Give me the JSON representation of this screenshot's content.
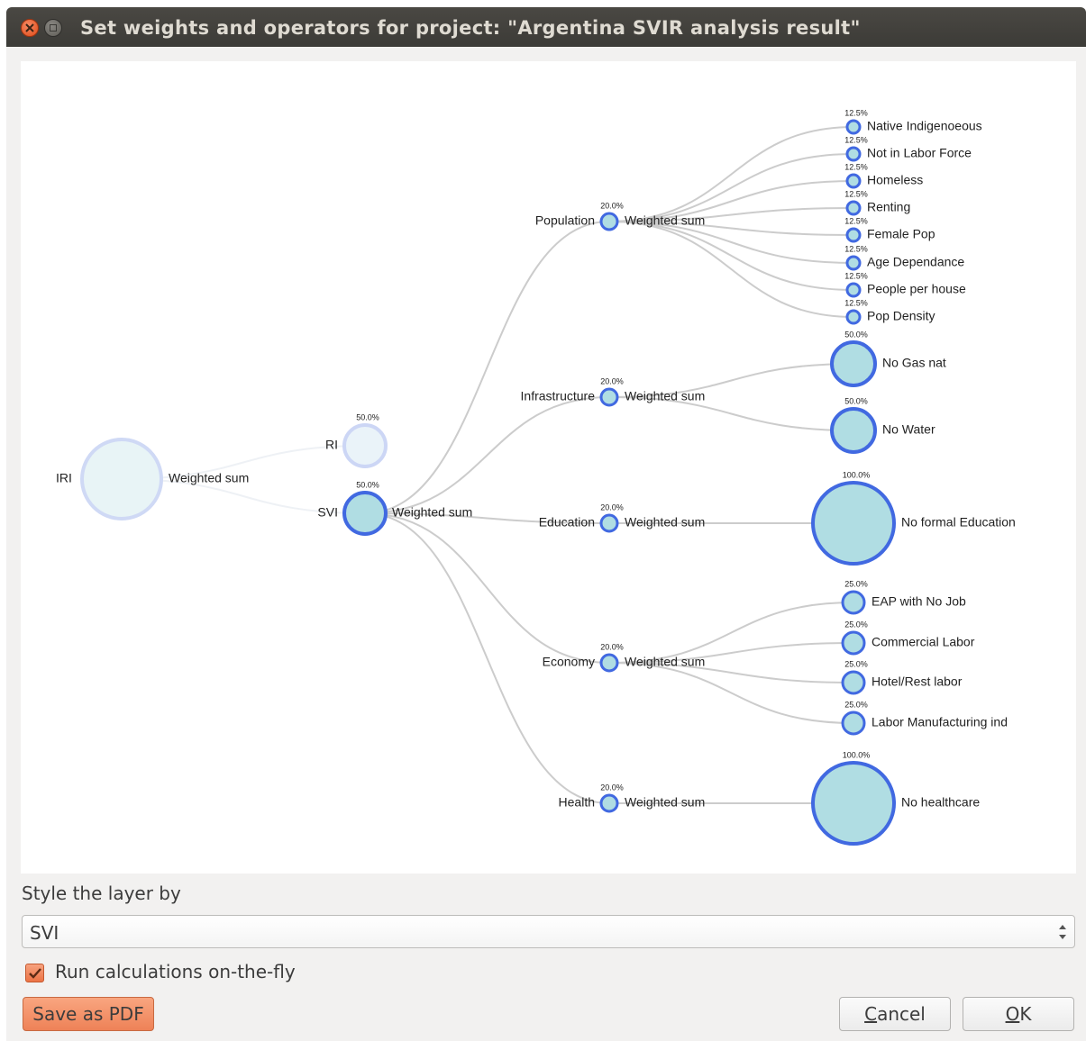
{
  "window": {
    "title": "Set weights and operators for project: \"Argentina SVIR analysis result\""
  },
  "tree": {
    "root": {
      "name": "IRI",
      "operator": "Weighted sum"
    },
    "level1": [
      {
        "name": "RI",
        "weight": "50.0%",
        "operator": ""
      },
      {
        "name": "SVI",
        "weight": "50.0%",
        "operator": "Weighted sum"
      }
    ],
    "themes": [
      {
        "name": "Population",
        "weight": "20.0%",
        "operator": "Weighted sum",
        "indicators": [
          {
            "name": "Native Indigenoeous",
            "weight": "12.5%"
          },
          {
            "name": "Not in Labor Force",
            "weight": "12.5%"
          },
          {
            "name": "Homeless",
            "weight": "12.5%"
          },
          {
            "name": "Renting",
            "weight": "12.5%"
          },
          {
            "name": "Female Pop",
            "weight": "12.5%"
          },
          {
            "name": "Age Dependance",
            "weight": "12.5%"
          },
          {
            "name": "People per house",
            "weight": "12.5%"
          },
          {
            "name": "Pop Density",
            "weight": "12.5%"
          }
        ]
      },
      {
        "name": "Infrastructure",
        "weight": "20.0%",
        "operator": "Weighted sum",
        "indicators": [
          {
            "name": "No Gas nat",
            "weight": "50.0%"
          },
          {
            "name": "No Water",
            "weight": "50.0%"
          }
        ]
      },
      {
        "name": "Education",
        "weight": "20.0%",
        "operator": "Weighted sum",
        "indicators": [
          {
            "name": "No formal Education",
            "weight": "100.0%"
          }
        ]
      },
      {
        "name": "Economy",
        "weight": "20.0%",
        "operator": "Weighted sum",
        "indicators": [
          {
            "name": "EAP with No Job",
            "weight": "25.0%"
          },
          {
            "name": "Commercial Labor",
            "weight": "25.0%"
          },
          {
            "name": "Hotel/Rest labor",
            "weight": "25.0%"
          },
          {
            "name": "Labor Manufacturing ind",
            "weight": "25.0%"
          }
        ]
      },
      {
        "name": "Health",
        "weight": "20.0%",
        "operator": "Weighted sum",
        "indicators": [
          {
            "name": "No healthcare",
            "weight": "100.0%"
          }
        ]
      }
    ]
  },
  "style": {
    "label": "Style the layer by",
    "selected": "SVI"
  },
  "onthefly": {
    "label": "Run calculations on-the-fly",
    "checked": true
  },
  "buttons": {
    "save_pdf": "Save as PDF",
    "cancel_first": "C",
    "cancel_rest": "ancel",
    "ok_first": "O",
    "ok_rest": "K"
  },
  "colors": {
    "node_fill": "#b0dde3",
    "node_stroke": "#4169e1",
    "root_fill": "#e8f4f6",
    "root_stroke": "#cfd9f5",
    "link": "#cccccc",
    "accent": "#f08a5d"
  }
}
